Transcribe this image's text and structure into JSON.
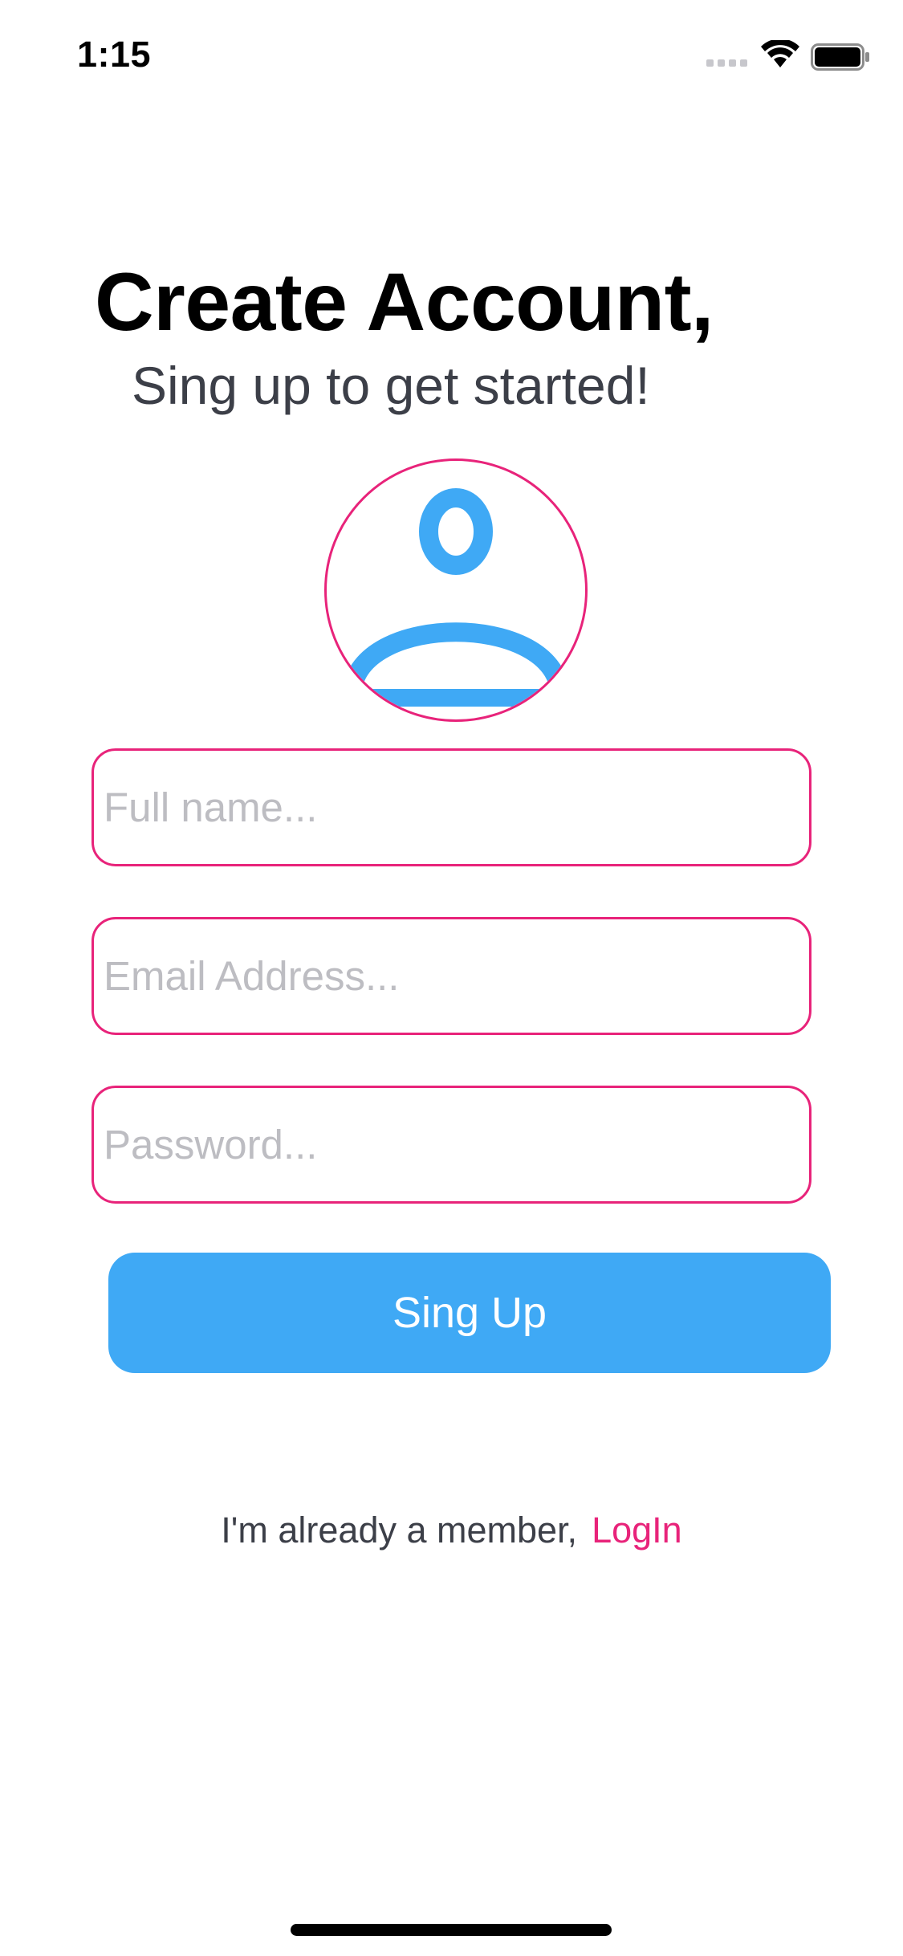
{
  "status_bar": {
    "time": "1:15",
    "signal_icon": "cellular-signal-icon",
    "wifi_icon": "wifi-icon",
    "battery_icon": "battery-full-icon"
  },
  "header": {
    "title": "Create Account,",
    "subtitle": "Sing up to get started!"
  },
  "avatar": {
    "icon": "user-avatar-icon",
    "icon_color": "#3fa9f5",
    "border_color": "#e8237a"
  },
  "form": {
    "full_name": {
      "placeholder": "Full name...",
      "value": ""
    },
    "email": {
      "placeholder": "Email Address...",
      "value": ""
    },
    "password": {
      "placeholder": "Password...",
      "value": ""
    },
    "field_border_color": "#e8237a"
  },
  "signup_button": {
    "label": "Sing Up",
    "color": "#3fa9f5"
  },
  "footer": {
    "member_text": "I'm already a member,",
    "login_label": "LogIn",
    "link_color": "#e8237a"
  }
}
